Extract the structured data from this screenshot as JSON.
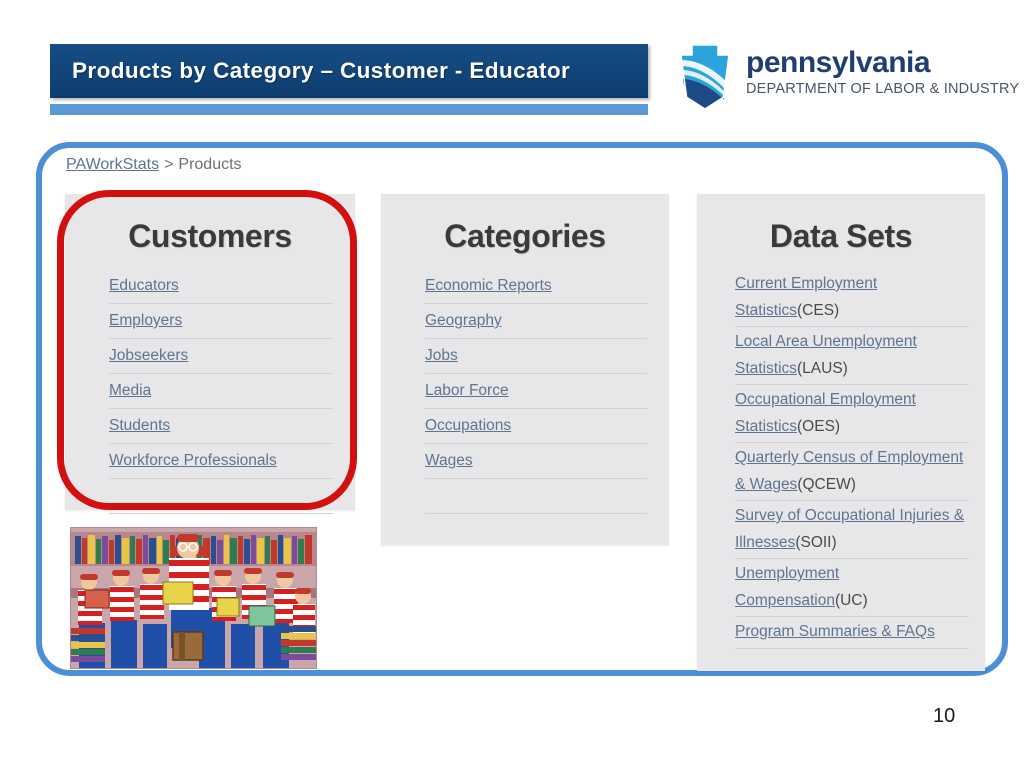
{
  "slide": {
    "title": "Products by Category – Customer - Educator",
    "page_number": "10",
    "accent_navy": "#11457a",
    "accent_light_blue": "#5b9bd5",
    "frame_blue": "#4a8fd8",
    "highlight_red": "#d40f0f",
    "panel_gray": "#e7e7e9",
    "link_color": "#5f7490"
  },
  "logo": {
    "name": "pennsylvania",
    "department": "DEPARTMENT OF LABOR & INDUSTRY",
    "icon": "keystone-icon"
  },
  "breadcrumb": {
    "root": "PAWorkStats",
    "separator": ">",
    "current": "Products"
  },
  "panels": {
    "customers": {
      "title": "Customers",
      "items": [
        {
          "label": "Educators",
          "suffix": ""
        },
        {
          "label": "Employers",
          "suffix": ""
        },
        {
          "label": "Jobseekers",
          "suffix": ""
        },
        {
          "label": "Media",
          "suffix": ""
        },
        {
          "label": "Students",
          "suffix": ""
        },
        {
          "label": "Workforce Professionals",
          "suffix": ""
        }
      ]
    },
    "categories": {
      "title": "Categories",
      "items": [
        {
          "label": "Economic Reports",
          "suffix": ""
        },
        {
          "label": "Geography",
          "suffix": ""
        },
        {
          "label": "Jobs",
          "suffix": ""
        },
        {
          "label": "Labor Force",
          "suffix": ""
        },
        {
          "label": "Occupations",
          "suffix": ""
        },
        {
          "label": "Wages",
          "suffix": ""
        }
      ]
    },
    "datasets": {
      "title": "Data Sets",
      "items": [
        {
          "label": "Current Employment Statistics",
          "suffix": "(CES)"
        },
        {
          "label": "Local Area Unemployment Statistics",
          "suffix": "(LAUS)"
        },
        {
          "label": "Occupational Employment Statistics",
          "suffix": "(OES)"
        },
        {
          "label": "Quarterly Census of Employment & Wages",
          "suffix": "(QCEW)"
        },
        {
          "label": "Survey of Occupational Injuries & Illnesses",
          "suffix": "(SOII)"
        },
        {
          "label": "Unemployment Compensation",
          "suffix": "(UC)"
        },
        {
          "label": "Program Summaries & FAQs",
          "suffix": ""
        }
      ]
    }
  },
  "illustration": {
    "name": "wheres-waldo-library-crowd-image",
    "alt": "Crowd of figures in red and white striped shirts reading books in a library"
  }
}
